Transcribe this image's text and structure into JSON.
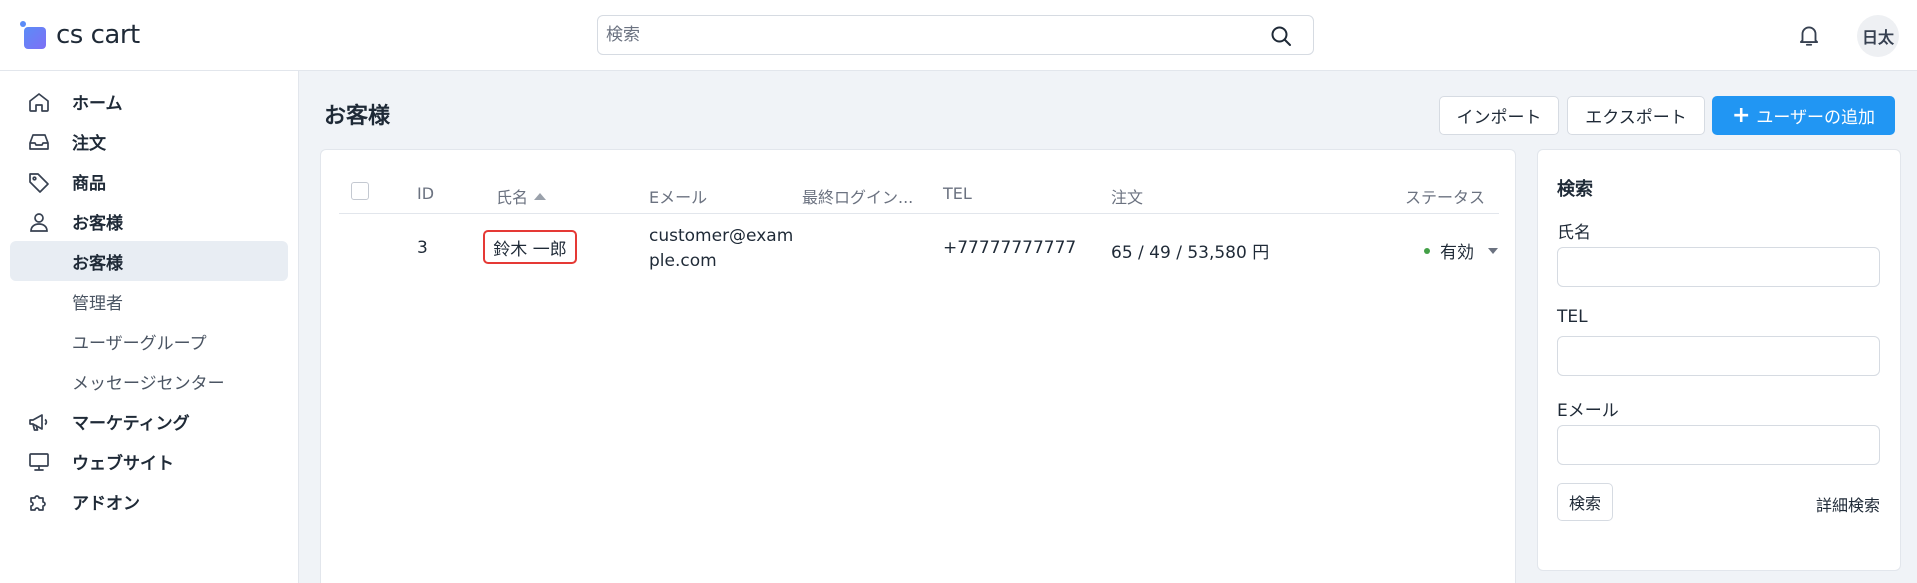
{
  "header": {
    "logo_text": "cs cart",
    "search_placeholder": "検索",
    "language": "日太"
  },
  "sidebar": {
    "items": [
      {
        "label": "ホーム",
        "icon": "home-icon"
      },
      {
        "label": "注文",
        "icon": "inbox-icon"
      },
      {
        "label": "商品",
        "icon": "tag-icon"
      },
      {
        "label": "お客様",
        "icon": "user-icon"
      },
      {
        "label": "マーケティング",
        "icon": "megaphone-icon"
      },
      {
        "label": "ウェブサイト",
        "icon": "monitor-icon"
      },
      {
        "label": "アドオン",
        "icon": "puzzle-icon"
      }
    ],
    "sub_items": [
      "お客様",
      "管理者",
      "ユーザーグループ",
      "メッセージセンター"
    ]
  },
  "main": {
    "title": "お客様",
    "buttons": {
      "import": "インポート",
      "export": "エクスポート",
      "add_user": "ユーザーの追加"
    },
    "table": {
      "columns": [
        "ID",
        "氏名",
        "Eメール",
        "最終ログイン...",
        "TEL",
        "注文",
        "ステータス"
      ],
      "rows": [
        {
          "id": "3",
          "name": "鈴木 一郎",
          "email_line1": "customer@exam",
          "email_line2": "ple.com",
          "last_login": "",
          "tel": "+77777777777",
          "orders": "65 / 49 / 53,580 円",
          "status": "有効"
        }
      ]
    }
  },
  "search_panel": {
    "title": "検索",
    "name_label": "氏名",
    "tel_label": "TEL",
    "email_label": "Eメール",
    "search_button": "検索",
    "advanced_link": "詳細検索"
  },
  "colors": {
    "accent": "#2196f3",
    "highlight_border": "#e53935",
    "status_active": "#43a047"
  }
}
